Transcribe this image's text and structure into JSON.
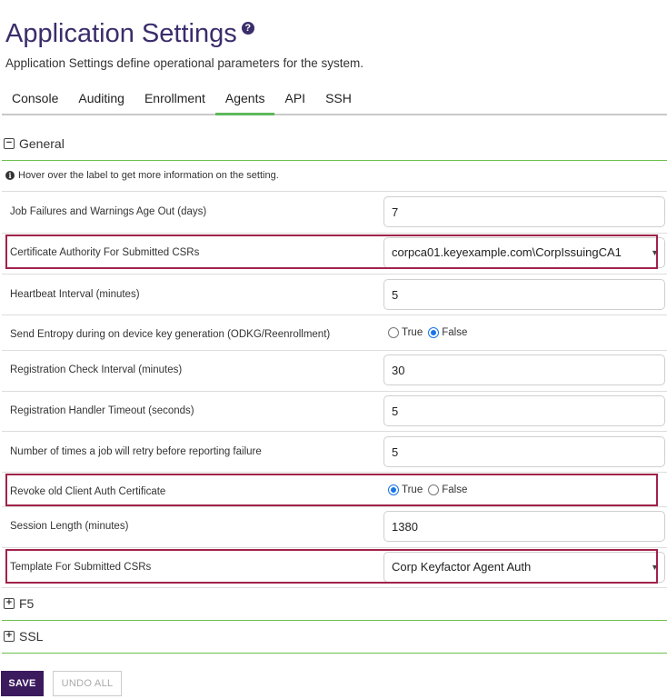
{
  "page": {
    "title": "Application Settings",
    "help_icon": "question-circle-icon",
    "subtitle": "Application Settings define operational parameters for the system."
  },
  "tabs": [
    {
      "label": "Console",
      "active": false
    },
    {
      "label": "Auditing",
      "active": false
    },
    {
      "label": "Enrollment",
      "active": false
    },
    {
      "label": "Agents",
      "active": true
    },
    {
      "label": "API",
      "active": false
    },
    {
      "label": "SSH",
      "active": false
    }
  ],
  "sections": {
    "general": {
      "label": "General",
      "toggle": "−",
      "expanded": true
    },
    "f5": {
      "label": "F5",
      "toggle": "+",
      "expanded": false
    },
    "ssl": {
      "label": "SSL",
      "toggle": "+",
      "expanded": false
    }
  },
  "info": {
    "icon": "info-circle-icon",
    "text": "Hover over the label to get more information on the setting."
  },
  "settings": {
    "job_failures": {
      "label": "Job Failures and Warnings Age Out (days)",
      "value": "7"
    },
    "ca_csr": {
      "label": "Certificate Authority For Submitted CSRs",
      "value": "corpca01.keyexample.com\\CorpIssuingCA1",
      "highlighted": true
    },
    "heartbeat": {
      "label": "Heartbeat Interval (minutes)",
      "value": "5"
    },
    "send_entropy": {
      "label": "Send Entropy during on device key generation (ODKG/Reenrollment)",
      "true_label": "True",
      "false_label": "False",
      "selected": "False"
    },
    "registration_check": {
      "label": "Registration Check Interval (minutes)",
      "value": "30"
    },
    "registration_timeout": {
      "label": "Registration Handler Timeout (seconds)",
      "value": "5"
    },
    "job_retry": {
      "label": "Number of times a job will retry before reporting failure",
      "value": "5"
    },
    "revoke_old": {
      "label": "Revoke old Client Auth Certificate",
      "true_label": "True",
      "false_label": "False",
      "selected": "True",
      "highlighted": true
    },
    "session_length": {
      "label": "Session Length (minutes)",
      "value": "1380"
    },
    "template_csr": {
      "label": "Template For Submitted CSRs",
      "value": "Corp Keyfactor Agent Auth",
      "highlighted": true
    }
  },
  "caret": "▼",
  "buttons": {
    "save": "SAVE",
    "undo_all": "UNDO ALL"
  },
  "colors": {
    "title": "#3b2d6b",
    "accent_green": "#5cb85c",
    "highlight_border": "#a1224a",
    "save_button": "#3b1a5e",
    "radio_selected": "#1a73e8"
  }
}
